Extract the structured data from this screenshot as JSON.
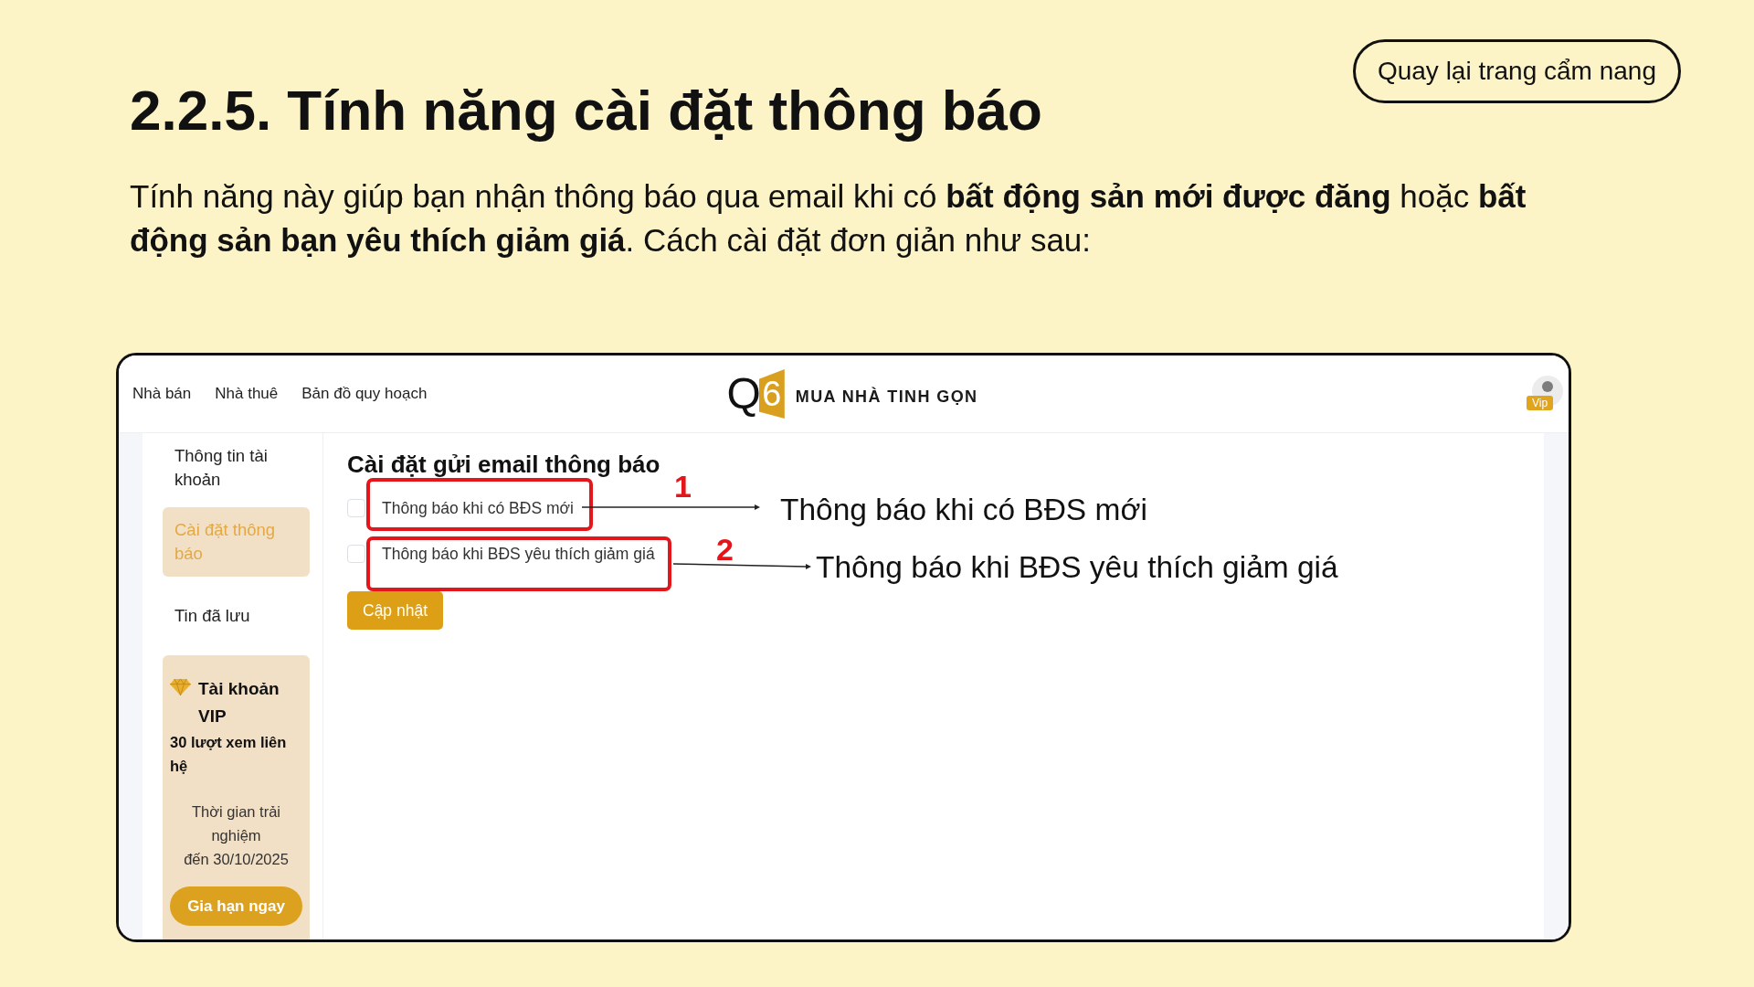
{
  "back_button": {
    "label": "Quay lại trang cẩm nang"
  },
  "title": "2.2.5. Tính năng cài đặt thông báo",
  "intro": "Tính năng này giúp bạn nhận thông báo qua email khi có **bất động sản mới được đăng** hoặc **bất động sản bạn yêu thích giảm giá**. Cách cài đặt đơn giản như sau:",
  "screenshot": {
    "nav": {
      "items": [
        {
          "label": "Nhà bán"
        },
        {
          "label": "Nhà thuê"
        },
        {
          "label": "Bản đồ quy hoạch"
        }
      ],
      "logo": {
        "letter": "Q",
        "digit": "6",
        "text": "MUA NHÀ TINH GỌN"
      },
      "account_badge": "Vip"
    },
    "sidebar": {
      "items": [
        {
          "label": "Thông tin tài khoản",
          "selected": false
        },
        {
          "label": "Cài đặt thông báo",
          "selected": true
        },
        {
          "label": "Tin đã lưu",
          "selected": false
        }
      ],
      "vip_card": {
        "title": "Tài khoản VIP",
        "views": "30 lượt xem liên hệ",
        "trial_lines": [
          "Thời gian trải nghiệm",
          "đến 30/10/2025"
        ],
        "button": "Gia hạn ngay"
      }
    },
    "settings": {
      "heading": "Cài đặt gửi email thông báo",
      "options": [
        {
          "label": "Thông báo khi có BĐS mới",
          "checked": false
        },
        {
          "label": "Thông báo khi BĐS yêu thích giảm giá",
          "checked": false
        }
      ],
      "button": "Cập nhật"
    }
  },
  "annotations": [
    {
      "number": "1",
      "text": "Thông báo khi có BĐS mới"
    },
    {
      "number": "2",
      "text": "Thông báo khi BĐS yêu thích giảm giá"
    }
  ]
}
